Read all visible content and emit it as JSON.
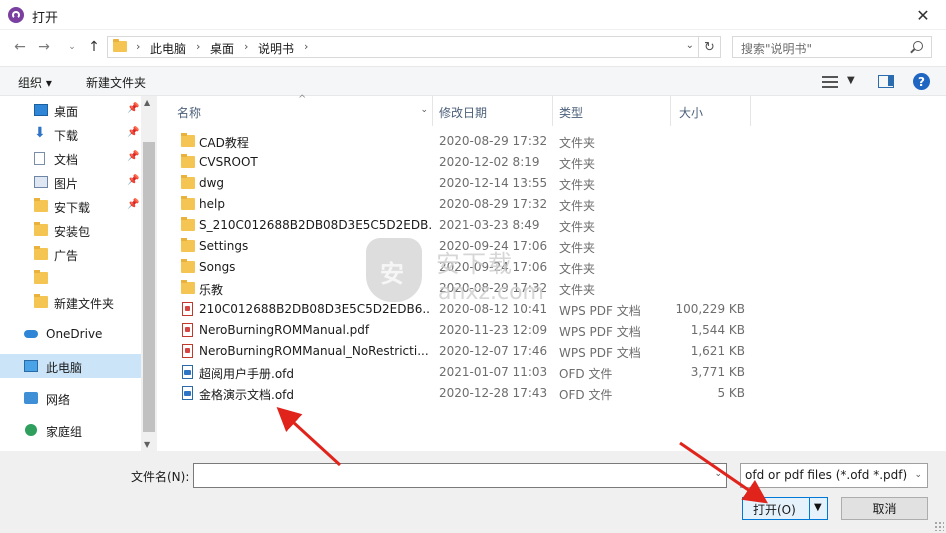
{
  "window": {
    "title": "打开"
  },
  "nav": {
    "breadcrumb": [
      "此电脑",
      "桌面",
      "说明书"
    ],
    "search_placeholder": "搜索\"说明书\""
  },
  "toolbar": {
    "organize_label": "组织 ▾",
    "new_folder_label": "新建文件夹"
  },
  "sidebar": {
    "items": [
      {
        "label": "桌面",
        "icon": "desktop-icon",
        "pinned": true
      },
      {
        "label": "下载",
        "icon": "download-icon",
        "pinned": true
      },
      {
        "label": "文档",
        "icon": "document-icon",
        "pinned": true
      },
      {
        "label": "图片",
        "icon": "picture-icon",
        "pinned": true
      },
      {
        "label": "安下载",
        "icon": "folder-icon",
        "pinned": true
      },
      {
        "label": "安装包",
        "icon": "folder-icon",
        "pinned": false
      },
      {
        "label": "广告",
        "icon": "folder-icon",
        "pinned": false
      },
      {
        "label": "",
        "icon": "folder-icon",
        "pinned": false
      },
      {
        "label": "新建文件夹",
        "icon": "folder-icon",
        "pinned": false
      },
      {
        "label": "OneDrive",
        "icon": "onedrive-icon",
        "pinned": false
      },
      {
        "label": "此电脑",
        "icon": "computer-icon",
        "pinned": false,
        "selected": true
      },
      {
        "label": "网络",
        "icon": "network-icon",
        "pinned": false
      },
      {
        "label": "家庭组",
        "icon": "homegroup-icon",
        "pinned": false
      }
    ]
  },
  "columns": {
    "name": "名称",
    "date": "修改日期",
    "type": "类型",
    "size": "大小"
  },
  "files": [
    {
      "name": "CAD教程",
      "date": "2020-08-29 17:32",
      "type": "文件夹",
      "size": "",
      "kind": "folder"
    },
    {
      "name": "CVSROOT",
      "date": "2020-12-02 8:19",
      "type": "文件夹",
      "size": "",
      "kind": "folder"
    },
    {
      "name": "dwg",
      "date": "2020-12-14 13:55",
      "type": "文件夹",
      "size": "",
      "kind": "folder"
    },
    {
      "name": "help",
      "date": "2020-08-29 17:32",
      "type": "文件夹",
      "size": "",
      "kind": "folder"
    },
    {
      "name": "S_210C012688B2DB08D3E5C5D2EDB...",
      "date": "2021-03-23 8:49",
      "type": "文件夹",
      "size": "",
      "kind": "folder"
    },
    {
      "name": "Settings",
      "date": "2020-09-24 17:06",
      "type": "文件夹",
      "size": "",
      "kind": "folder"
    },
    {
      "name": "Songs",
      "date": "2020-09-24 17:06",
      "type": "文件夹",
      "size": "",
      "kind": "folder"
    },
    {
      "name": "乐教",
      "date": "2020-08-29 17:32",
      "type": "文件夹",
      "size": "",
      "kind": "folder"
    },
    {
      "name": "210C012688B2DB08D3E5C5D2EDB6...",
      "date": "2020-08-12 10:41",
      "type": "WPS PDF 文档",
      "size": "100,229 KB",
      "kind": "pdf"
    },
    {
      "name": "NeroBurningROMManual.pdf",
      "date": "2020-11-23 12:09",
      "type": "WPS PDF 文档",
      "size": "1,544 KB",
      "kind": "pdf"
    },
    {
      "name": "NeroBurningROMManual_NoRestricti...",
      "date": "2020-12-07 17:46",
      "type": "WPS PDF 文档",
      "size": "1,621 KB",
      "kind": "pdf"
    },
    {
      "name": "超阅用户手册.ofd",
      "date": "2021-01-07 11:03",
      "type": "OFD 文件",
      "size": "3,771 KB",
      "kind": "ofd"
    },
    {
      "name": "金格演示文档.ofd",
      "date": "2020-12-28 17:43",
      "type": "OFD 文件",
      "size": "5 KB",
      "kind": "ofd"
    }
  ],
  "watermark": {
    "text": "安下载",
    "domain": "anxz.com"
  },
  "footer": {
    "filename_label": "文件名(N):",
    "filename_value": "",
    "filter_value": "ofd or pdf files (*.ofd *.pdf)",
    "open_label": "打开(O)",
    "cancel_label": "取消"
  },
  "colors": {
    "accent": "#0078d7",
    "selected_row": "#cce4f7",
    "annotation": "#e0241b"
  }
}
